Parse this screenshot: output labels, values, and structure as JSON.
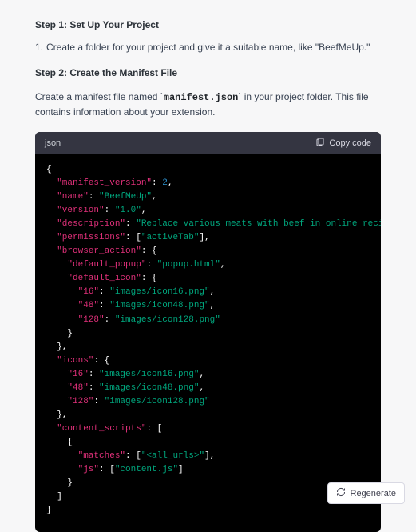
{
  "step1": {
    "label": "Step 1:",
    "title": "Set Up Your Project",
    "item_number": "1.",
    "item_text": "Create a folder for your project and give it a suitable name, like \"BeefMeUp.\""
  },
  "step2": {
    "label": "Step 2:",
    "title": "Create the Manifest File",
    "intro_before": "Create a manifest file named ",
    "intro_code_open": "`",
    "intro_code": "manifest.json",
    "intro_code_close": "`",
    "intro_after": " in your project folder. This file contains information about your extension."
  },
  "code": {
    "language": "json",
    "copy_label": "Copy code",
    "tokens": [
      [
        {
          "t": "brace",
          "v": "{"
        }
      ],
      [
        {
          "t": "sp",
          "v": "  "
        },
        {
          "t": "key",
          "v": "\"manifest_version\""
        },
        {
          "t": "punc",
          "v": ": "
        },
        {
          "t": "num",
          "v": "2"
        },
        {
          "t": "punc",
          "v": ","
        }
      ],
      [
        {
          "t": "sp",
          "v": "  "
        },
        {
          "t": "key",
          "v": "\"name\""
        },
        {
          "t": "punc",
          "v": ": "
        },
        {
          "t": "str",
          "v": "\"BeefMeUp\""
        },
        {
          "t": "punc",
          "v": ","
        }
      ],
      [
        {
          "t": "sp",
          "v": "  "
        },
        {
          "t": "key",
          "v": "\"version\""
        },
        {
          "t": "punc",
          "v": ": "
        },
        {
          "t": "str",
          "v": "\"1.0\""
        },
        {
          "t": "punc",
          "v": ","
        }
      ],
      [
        {
          "t": "sp",
          "v": "  "
        },
        {
          "t": "key",
          "v": "\"description\""
        },
        {
          "t": "punc",
          "v": ": "
        },
        {
          "t": "str",
          "v": "\"Replace various meats with beef in online recipes.\""
        },
        {
          "t": "punc",
          "v": ","
        }
      ],
      [
        {
          "t": "sp",
          "v": "  "
        },
        {
          "t": "key",
          "v": "\"permissions\""
        },
        {
          "t": "punc",
          "v": ": ["
        },
        {
          "t": "str",
          "v": "\"activeTab\""
        },
        {
          "t": "punc",
          "v": "],"
        }
      ],
      [
        {
          "t": "sp",
          "v": "  "
        },
        {
          "t": "key",
          "v": "\"browser_action\""
        },
        {
          "t": "punc",
          "v": ": {"
        }
      ],
      [
        {
          "t": "sp",
          "v": "    "
        },
        {
          "t": "key",
          "v": "\"default_popup\""
        },
        {
          "t": "punc",
          "v": ": "
        },
        {
          "t": "str",
          "v": "\"popup.html\""
        },
        {
          "t": "punc",
          "v": ","
        }
      ],
      [
        {
          "t": "sp",
          "v": "    "
        },
        {
          "t": "key",
          "v": "\"default_icon\""
        },
        {
          "t": "punc",
          "v": ": {"
        }
      ],
      [
        {
          "t": "sp",
          "v": "      "
        },
        {
          "t": "key",
          "v": "\"16\""
        },
        {
          "t": "punc",
          "v": ": "
        },
        {
          "t": "str",
          "v": "\"images/icon16.png\""
        },
        {
          "t": "punc",
          "v": ","
        }
      ],
      [
        {
          "t": "sp",
          "v": "      "
        },
        {
          "t": "key",
          "v": "\"48\""
        },
        {
          "t": "punc",
          "v": ": "
        },
        {
          "t": "str",
          "v": "\"images/icon48.png\""
        },
        {
          "t": "punc",
          "v": ","
        }
      ],
      [
        {
          "t": "sp",
          "v": "      "
        },
        {
          "t": "key",
          "v": "\"128\""
        },
        {
          "t": "punc",
          "v": ": "
        },
        {
          "t": "str",
          "v": "\"images/icon128.png\""
        }
      ],
      [
        {
          "t": "sp",
          "v": "    "
        },
        {
          "t": "brace",
          "v": "}"
        }
      ],
      [
        {
          "t": "sp",
          "v": "  "
        },
        {
          "t": "brace",
          "v": "},"
        }
      ],
      [
        {
          "t": "sp",
          "v": "  "
        },
        {
          "t": "key",
          "v": "\"icons\""
        },
        {
          "t": "punc",
          "v": ": {"
        }
      ],
      [
        {
          "t": "sp",
          "v": "    "
        },
        {
          "t": "key",
          "v": "\"16\""
        },
        {
          "t": "punc",
          "v": ": "
        },
        {
          "t": "str",
          "v": "\"images/icon16.png\""
        },
        {
          "t": "punc",
          "v": ","
        }
      ],
      [
        {
          "t": "sp",
          "v": "    "
        },
        {
          "t": "key",
          "v": "\"48\""
        },
        {
          "t": "punc",
          "v": ": "
        },
        {
          "t": "str",
          "v": "\"images/icon48.png\""
        },
        {
          "t": "punc",
          "v": ","
        }
      ],
      [
        {
          "t": "sp",
          "v": "    "
        },
        {
          "t": "key",
          "v": "\"128\""
        },
        {
          "t": "punc",
          "v": ": "
        },
        {
          "t": "str",
          "v": "\"images/icon128.png\""
        }
      ],
      [
        {
          "t": "sp",
          "v": "  "
        },
        {
          "t": "brace",
          "v": "},"
        }
      ],
      [
        {
          "t": "sp",
          "v": "  "
        },
        {
          "t": "key",
          "v": "\"content_scripts\""
        },
        {
          "t": "punc",
          "v": ": ["
        }
      ],
      [
        {
          "t": "sp",
          "v": "    "
        },
        {
          "t": "brace",
          "v": "{"
        }
      ],
      [
        {
          "t": "sp",
          "v": "      "
        },
        {
          "t": "key",
          "v": "\"matches\""
        },
        {
          "t": "punc",
          "v": ": ["
        },
        {
          "t": "str",
          "v": "\"<all_urls>\""
        },
        {
          "t": "punc",
          "v": "],"
        }
      ],
      [
        {
          "t": "sp",
          "v": "      "
        },
        {
          "t": "key",
          "v": "\"js\""
        },
        {
          "t": "punc",
          "v": ": ["
        },
        {
          "t": "str",
          "v": "\"content.js\""
        },
        {
          "t": "punc",
          "v": "]"
        }
      ],
      [
        {
          "t": "sp",
          "v": "    "
        },
        {
          "t": "brace",
          "v": "}"
        }
      ],
      [
        {
          "t": "sp",
          "v": "  "
        },
        {
          "t": "brace",
          "v": "]"
        }
      ],
      [
        {
          "t": "brace",
          "v": "}"
        }
      ]
    ]
  },
  "regenerate_label": "Regenerate"
}
